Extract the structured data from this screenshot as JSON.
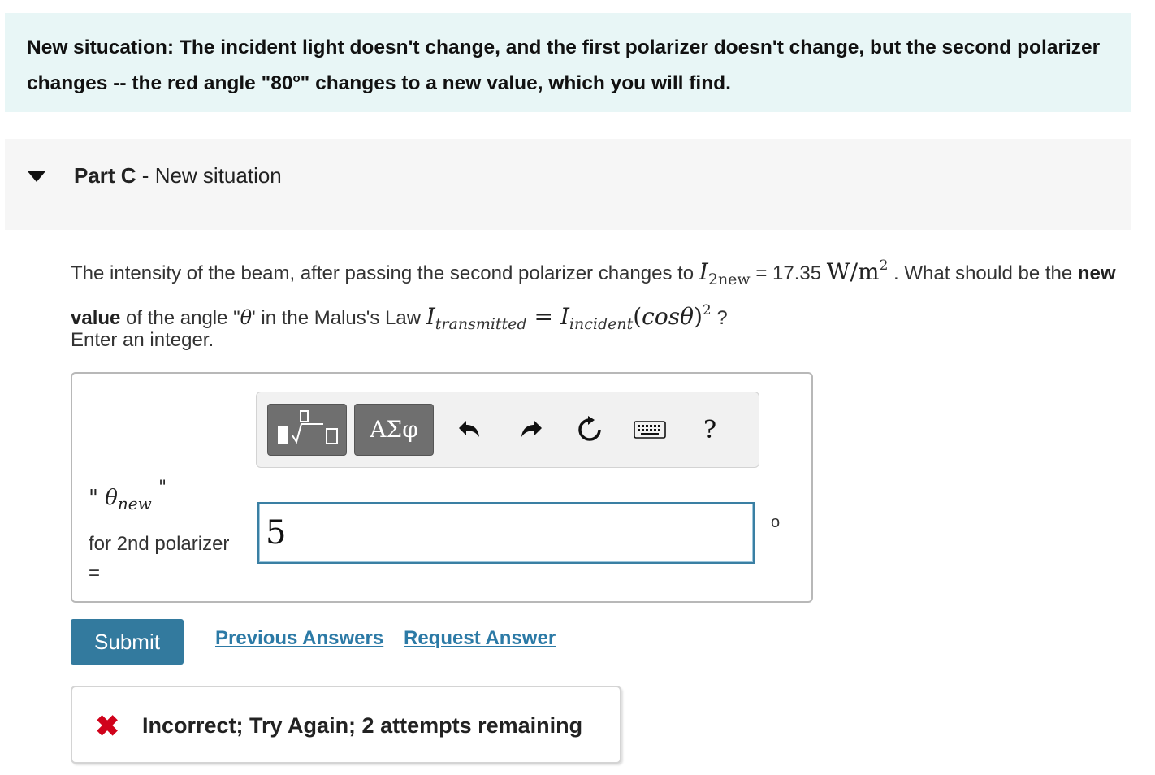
{
  "intro": {
    "text_before": "New situcation: The incident light doesn't change, and the first polarizer doesn't change, but the second polarizer changes -- the red angle \"80",
    "degree_sup": "o",
    "text_after": "\" changes to a new value, which you will find."
  },
  "part": {
    "label": "Part C",
    "separator": " - ",
    "title": "New situation"
  },
  "question": {
    "t1": "The intensity of the beam, after passing the second polarizer changes to ",
    "i_symbol": "I",
    "i_sub": "2new",
    "eq_value": " = 17.35 ",
    "unit_w": "W",
    "unit_slash": "/",
    "unit_m": "m",
    "unit_exp": "2",
    "t2": " . What should be the ",
    "bold": "new value",
    "t3": " of the angle \"",
    "theta": "θ",
    "t4": "' in the  Malus's Law ",
    "law_i1": "I",
    "law_sub1": "transmitted",
    "law_eq": " = ",
    "law_i2": "I",
    "law_sub2": "incident",
    "law_paren_open": "(",
    "law_cos": "cos",
    "law_theta": "θ",
    "law_paren_close": ")",
    "law_exp": "2",
    "t5": " ?"
  },
  "instruction": "Enter an integer.",
  "toolbar": {
    "greek_label": "ΑΣφ",
    "help_label": "?",
    "icons": [
      "templates-icon",
      "greek-icon",
      "undo-icon",
      "redo-icon",
      "reset-icon",
      "keyboard-icon",
      "help-icon"
    ]
  },
  "answer": {
    "label_open_quote": "\"",
    "label_theta": "θ",
    "label_sub": "new",
    "label_close_quote": "\"",
    "label_for": "for 2nd polarizer",
    "label_eq": "=",
    "value": "5",
    "unit": "o"
  },
  "actions": {
    "submit_label": "Submit",
    "previous_label": "Previous Answers",
    "request_label": "Request Answer"
  },
  "feedback": {
    "icon": "✖",
    "text": "Incorrect; Try Again; 2 attempts remaining"
  },
  "colors": {
    "intro_bg": "#e8f6f6",
    "submit_bg": "#337a9e",
    "link": "#2c7aa6",
    "error": "#d0021b"
  }
}
